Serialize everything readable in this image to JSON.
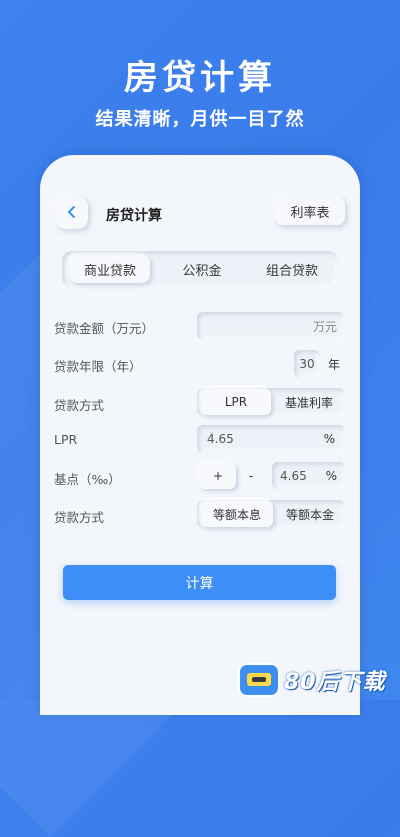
{
  "promo": {
    "title": "房贷计算",
    "subtitle": "结果清晰，月供一目了然"
  },
  "header": {
    "back_icon": "chevron-left-icon",
    "title": "房贷计算",
    "rate_table_label": "利率表"
  },
  "tabs": [
    {
      "label": "商业贷款",
      "active": true
    },
    {
      "label": "公积金",
      "active": false
    },
    {
      "label": "组合贷款",
      "active": false
    }
  ],
  "form": {
    "amount": {
      "label": "贷款金额（万元）",
      "unit": "万元",
      "value": ""
    },
    "years": {
      "label": "贷款年限（年）",
      "value": "30",
      "unit": "年"
    },
    "loan_mode": {
      "label": "贷款方式",
      "options": [
        "LPR",
        "基准利率"
      ],
      "selected": "LPR"
    },
    "lpr": {
      "label": "LPR",
      "value": "4.65",
      "unit": "%"
    },
    "basis": {
      "label": "基点（‰）",
      "plus": "+",
      "minus": "-",
      "value": "4.65",
      "unit": "%"
    },
    "repay_mode": {
      "label": "贷款方式",
      "options": [
        "等额本息",
        "等额本金"
      ],
      "selected": "等额本息"
    }
  },
  "calculate_label": "计算",
  "watermark": {
    "text": "80后下载"
  },
  "colors": {
    "background": "#3e82ef",
    "accent": "#3d8ef6",
    "card": "#f3f6fb"
  }
}
